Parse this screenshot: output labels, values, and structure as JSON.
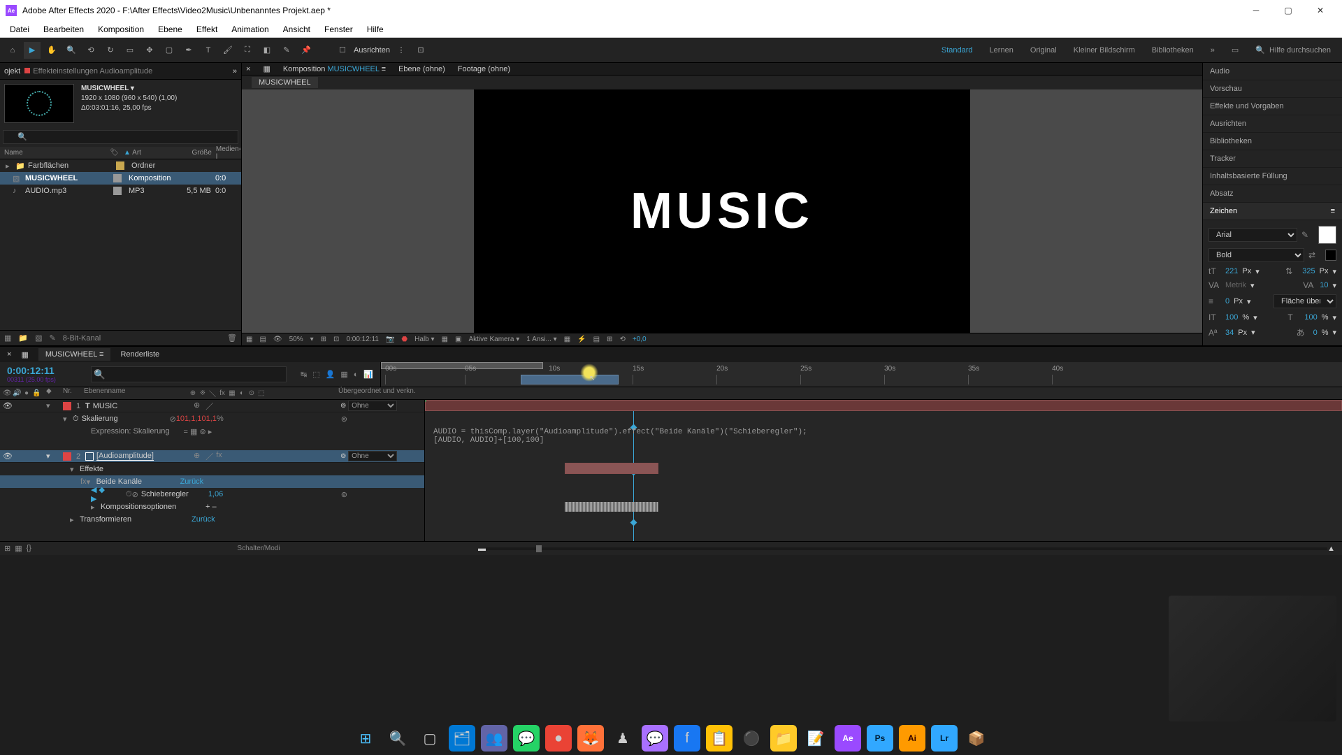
{
  "titlebar": {
    "logo": "Ae",
    "title": "Adobe After Effects 2020 - F:\\After Effects\\Video2Music\\Unbenanntes Projekt.aep *"
  },
  "menu": [
    "Datei",
    "Bearbeiten",
    "Komposition",
    "Ebene",
    "Effekt",
    "Animation",
    "Ansicht",
    "Fenster",
    "Hilfe"
  ],
  "toolbar": {
    "align": "Ausrichten",
    "workspaces": [
      "Standard",
      "Lernen",
      "Original",
      "Kleiner Bildschirm",
      "Bibliotheken"
    ],
    "search_placeholder": "Hilfe durchsuchen"
  },
  "project": {
    "tabs": {
      "project": "ojekt",
      "effects": "Effekteinstellungen Audioamplitude"
    },
    "comp": {
      "name": "MUSICWHEEL",
      "res": "1920 x 1080 (960 x 540) (1,00)",
      "dur": "Δ0:03:01:16, 25,00 fps"
    },
    "columns": {
      "name": "Name",
      "art": "Art",
      "size": "Größe",
      "media": "Medien-l"
    },
    "items": [
      {
        "name": "Farbflächen",
        "art": "Ordner",
        "size": "",
        "media": "",
        "icon": "📁",
        "tag": "folder"
      },
      {
        "name": "MUSICWHEEL",
        "art": "Komposition",
        "size": "",
        "media": "0:0",
        "icon": "▧",
        "selected": true
      },
      {
        "name": "AUDIO.mp3",
        "art": "MP3",
        "size": "5,5 MB",
        "media": "0:0",
        "icon": "♪"
      }
    ],
    "footer": "8-Bit-Kanal"
  },
  "viewer": {
    "tabs": {
      "comp_prefix": "Komposition",
      "comp_name": "MUSICWHEEL",
      "layer": "Ebene (ohne)",
      "footage": "Footage (ohne)"
    },
    "breadcrumb": "MUSICWHEEL",
    "canvas_text": "MUSIC",
    "footer": {
      "zoom": "50%",
      "time": "0:00:12:11",
      "res": "Halb",
      "camera": "Aktive Kamera",
      "views": "1 Ansi...",
      "exposure": "+0,0"
    }
  },
  "right_panels": [
    "Audio",
    "Vorschau",
    "Effekte und Vorgaben",
    "Ausrichten",
    "Bibliotheken",
    "Tracker",
    "Inhaltsbasierte Füllung",
    "Absatz"
  ],
  "char": {
    "title": "Zeichen",
    "font": "Arial",
    "weight": "Bold",
    "size": "221",
    "size_unit": "Px",
    "leading": "325",
    "leading_unit": "Px",
    "kerning": "Metrik",
    "tracking": "10",
    "stroke": "0",
    "stroke_unit": "Px",
    "fill_over": "Fläche über Kon...",
    "vscale": "100",
    "hscale": "100",
    "scale_unit": "%",
    "baseline": "34",
    "baseline_unit": "Px",
    "tsume": "0",
    "tsume_unit": "%"
  },
  "timeline": {
    "tabs": {
      "comp": "MUSICWHEEL",
      "render": "Renderliste"
    },
    "time": "0:00:12:11",
    "time_sub": "00311 (25.00 fps)",
    "ticks": [
      "00s",
      "05s",
      "10s",
      "15s",
      "20s",
      "25s",
      "30s",
      "35s",
      "40s"
    ],
    "col_headers": {
      "nr": "Nr.",
      "name": "Ebenenname",
      "parent": "Übergeordnet und verkn."
    },
    "layers": [
      {
        "num": "1",
        "name": "MUSIC",
        "type": "T",
        "tag": "#d44",
        "parent": "Ohne"
      },
      {
        "num": "2",
        "name": "[Audioamplitude]",
        "type": "□",
        "tag": "#d44",
        "parent": "Ohne",
        "selected": true
      }
    ],
    "props": {
      "skalierung": "Skalierung",
      "skalierung_val": "101,1,101,1",
      "skalierung_unit": "%",
      "expression_label": "Expression: Skalierung",
      "effekte": "Effekte",
      "beide_kanale": "Beide Kanäle",
      "beide_kanale_val": "Zurück",
      "schieberegler": "Schieberegler",
      "schieberegler_val": "1,06",
      "komp_optionen": "Kompositionsoptionen",
      "komp_optionen_val": "+ –",
      "transformieren": "Transformieren",
      "transformieren_val": "Zurück"
    },
    "expression": "AUDIO = thisComp.layer(\"Audioamplitude\").effect(\"Beide Kanäle\")(\"Schieberegler\");\n[AUDIO, AUDIO]+[100,100]",
    "footer": "Schalter/Modi"
  },
  "chart_data": {
    "type": "table",
    "note": "screenshot is a DAW-like UI; no chart"
  }
}
